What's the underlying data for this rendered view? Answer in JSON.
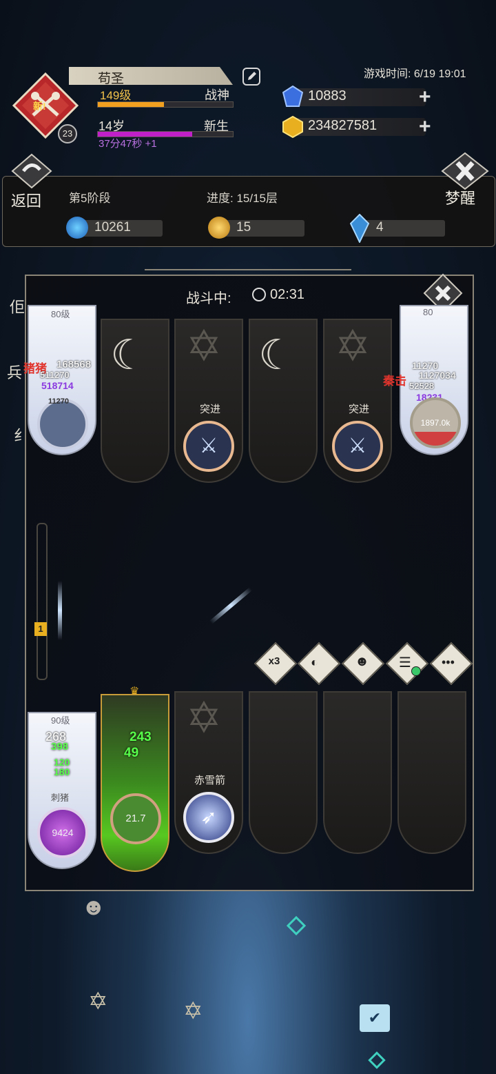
{
  "player": {
    "name": "苟圣",
    "level": "149级",
    "rank": "战神",
    "age": "14岁",
    "status": "新生",
    "timer": "37分47秒 +1",
    "avatar_badge": "新!",
    "avatar_level": "23"
  },
  "game_time": "游戏时间: 6/19 19:01",
  "resources": {
    "diamond": "10883",
    "gold": "234827581"
  },
  "stage": {
    "back_label": "返回",
    "dream_label": "梦醒",
    "phase": "第5阶段",
    "progress": "进度: 15/15层",
    "soul": "10261",
    "coin": "15",
    "crystal": "4"
  },
  "battle": {
    "title": "战斗中:",
    "time": "02:31",
    "side_labels": [
      "佢",
      "兵",
      "纟"
    ],
    "enemy_row": {
      "left_card": {
        "level": "80级",
        "name": "猪猪",
        "dmg_red": "168568",
        "dmg_white1": "511270",
        "dmg_purple": "518714",
        "dmg_small": "11270"
      },
      "right_card": {
        "level": "80",
        "name": "秦击",
        "dmg1": "11270",
        "dmg2": "1127034",
        "dmg3": "52528",
        "dmg_purple": "18231",
        "circle": "1897.0k"
      },
      "slot2_label": "突进",
      "slot4_label": "突进"
    },
    "player_row": {
      "card1": {
        "level": "90级",
        "top": "268",
        "top2": "398",
        "mid1": "120",
        "mid2": "180",
        "name": "刺猪",
        "circle": "9424"
      },
      "card2": {
        "dmg1": "243",
        "dmg2": "49",
        "circle": "21.7"
      },
      "slot3_label": "赤雪箭"
    },
    "actions": [
      "x3"
    ],
    "track_marker": "1"
  },
  "colors": {
    "accent_gold": "#f2c24a",
    "accent_purple": "#b970e0",
    "damage_red": "#e0342c",
    "damage_green": "#58ff4a"
  }
}
